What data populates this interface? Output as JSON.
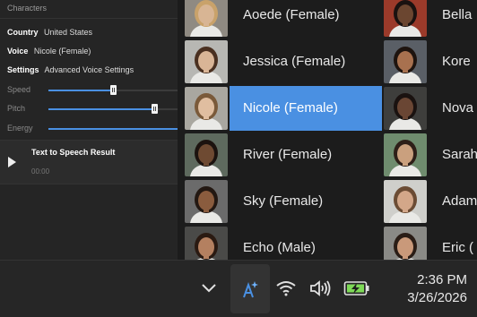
{
  "panel": {
    "header": "Characters",
    "country_label": "Country",
    "country_value": "United States",
    "voice_label": "Voice",
    "voice_value": "Nicole (Female)",
    "settings_label": "Settings",
    "settings_value": "Advanced Voice Settings",
    "sliders": [
      {
        "label": "Speed",
        "value": 0.5
      },
      {
        "label": "Pitch",
        "value": 0.82
      },
      {
        "label": "Energy",
        "value": 1.0
      }
    ],
    "tts": {
      "title": "Text to Speech Result",
      "time": "00:00"
    }
  },
  "voices": [
    {
      "name": "Aoede (Female)",
      "skin": "#d8b594",
      "hair": "#c9a26a",
      "bg": "#8f8a82"
    },
    {
      "name": "Jessica (Female)",
      "skin": "#d9b596",
      "hair": "#4a3020",
      "bg": "#b7b7b3"
    },
    {
      "name": "Nicole (Female)",
      "skin": "#e0bea0",
      "hair": "#7a5a3a",
      "bg": "#a9a7a0",
      "selected": true
    },
    {
      "name": "River (Female)",
      "skin": "#6e4a32",
      "hair": "#1c130f",
      "bg": "#5e6a5e"
    },
    {
      "name": "Sky (Female)",
      "skin": "#8a5c3e",
      "hair": "#231812",
      "bg": "#6b6b6b"
    },
    {
      "name": "Echo (Male)",
      "skin": "#b48060",
      "hair": "#2a1a12",
      "bg": "#4a4a48"
    },
    {
      "name": "Bella",
      "skin": "#6b4630",
      "hair": "#1a1210",
      "bg": "#9b3a2a"
    },
    {
      "name": "Kore",
      "skin": "#a8714f",
      "hair": "#1e140f",
      "bg": "#5a5f66"
    },
    {
      "name": "Nova",
      "skin": "#6a4634",
      "hair": "#1a1210",
      "bg": "#3e3e3c"
    },
    {
      "name": "Sarah",
      "skin": "#caa07e",
      "hair": "#2e1f18",
      "bg": "#6f8c6e"
    },
    {
      "name": "Adam",
      "skin": "#d3a789",
      "hair": "#6b4c34",
      "bg": "#cfcfcb"
    },
    {
      "name": "Eric (",
      "skin": "#c9997a",
      "hair": "#2a1d16",
      "bg": "#8a8a86"
    }
  ],
  "taskbar": {
    "icons": [
      "chevron-up-icon",
      "copilot-icon",
      "wifi-icon",
      "volume-icon",
      "battery-charging-icon"
    ],
    "time": "2:36 PM",
    "date": "3/26/2026"
  },
  "colors": {
    "accent": "#4a90e2",
    "battery": "#7ed957"
  }
}
